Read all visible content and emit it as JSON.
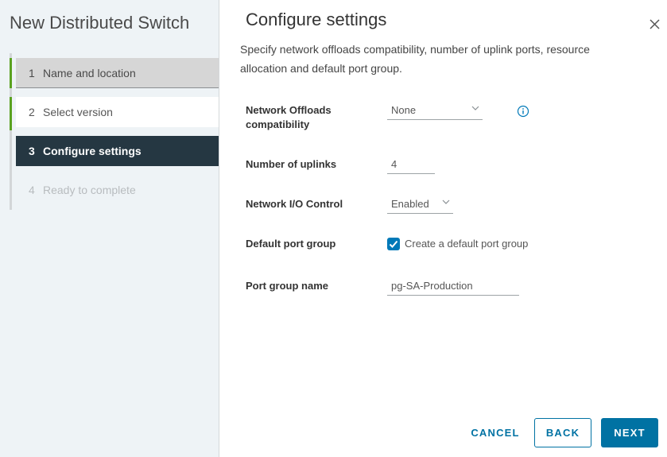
{
  "wizard": {
    "title": "New Distributed Switch",
    "steps": [
      {
        "number": "1",
        "label": "Name and location",
        "state": "completed"
      },
      {
        "number": "2",
        "label": "Select version",
        "state": "completed"
      },
      {
        "number": "3",
        "label": "Configure settings",
        "state": "active"
      },
      {
        "number": "4",
        "label": "Ready to complete",
        "state": "upcoming"
      }
    ]
  },
  "main": {
    "heading": "Configure settings",
    "description": "Specify network offloads compatibility, number of uplink ports, resource allocation and default port group.",
    "fields": {
      "network_offloads": {
        "label_line1": "Network Offloads",
        "label_line2": "compatibility",
        "value": "None"
      },
      "uplinks": {
        "label": "Number of uplinks",
        "value": "4"
      },
      "nioc": {
        "label": "Network I/O Control",
        "value": "Enabled"
      },
      "default_port_group": {
        "label": "Default port group",
        "checkbox_label": "Create a default port group",
        "checked": true
      },
      "port_group_name": {
        "label": "Port group name",
        "value": "pg-SA-Production"
      }
    }
  },
  "footer": {
    "cancel": "CANCEL",
    "back": "BACK",
    "next": "NEXT"
  },
  "colors": {
    "accent": "#0072a3",
    "completed_bar": "#5aa220",
    "active_step_bg": "#253742"
  },
  "icons": {
    "close": "close-icon",
    "info": "info-icon",
    "chevron": "chevron-down-icon",
    "check": "checkmark-icon"
  }
}
